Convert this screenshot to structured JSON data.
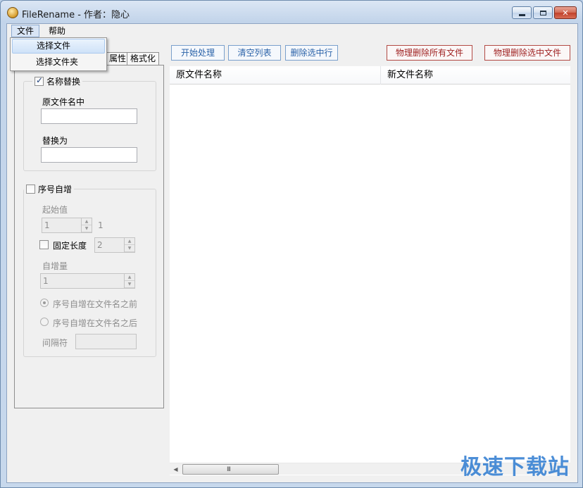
{
  "window": {
    "title": "FileRename - 作者：隐心"
  },
  "menubar": {
    "items": [
      {
        "label": "文件"
      },
      {
        "label": "帮助"
      }
    ]
  },
  "file_menu": {
    "items": [
      {
        "label": "选择文件"
      },
      {
        "label": "选择文件夹"
      }
    ]
  },
  "tabs": [
    {
      "label": "属性"
    },
    {
      "label": "格式化"
    }
  ],
  "name_replace": {
    "title": "名称替换",
    "checked": true,
    "original_label": "原文件名中",
    "original_value": "",
    "replace_label": "替换为",
    "replace_value": ""
  },
  "sequence": {
    "title": "序号自增",
    "checked": false,
    "start_label": "起始值",
    "start_value": "1",
    "start_preview": "1",
    "fixed_length_label": "固定长度",
    "fixed_length_value": "2",
    "increment_label": "自增量",
    "increment_value": "1",
    "radio_before": "序号自增在文件名之前",
    "radio_after": "序号自增在文件名之后",
    "separator_label": "间隔符",
    "separator_value": ""
  },
  "toolbar": {
    "start_label": "开始处理",
    "clear_label": "清空列表",
    "delete_row_label": "删除选中行",
    "phys_delete_all_label": "物理删除所有文件",
    "phys_delete_selected_label": "物理删除选中文件"
  },
  "list": {
    "columns": [
      "原文件名称",
      "新文件名称"
    ]
  },
  "scrollbar": {
    "grip": "III"
  },
  "watermark": "极速下载站",
  "colors": {
    "accent_button_text": "#2a62a8",
    "danger_button_text": "#9e1f1f",
    "watermark": "#2d7bd1"
  }
}
